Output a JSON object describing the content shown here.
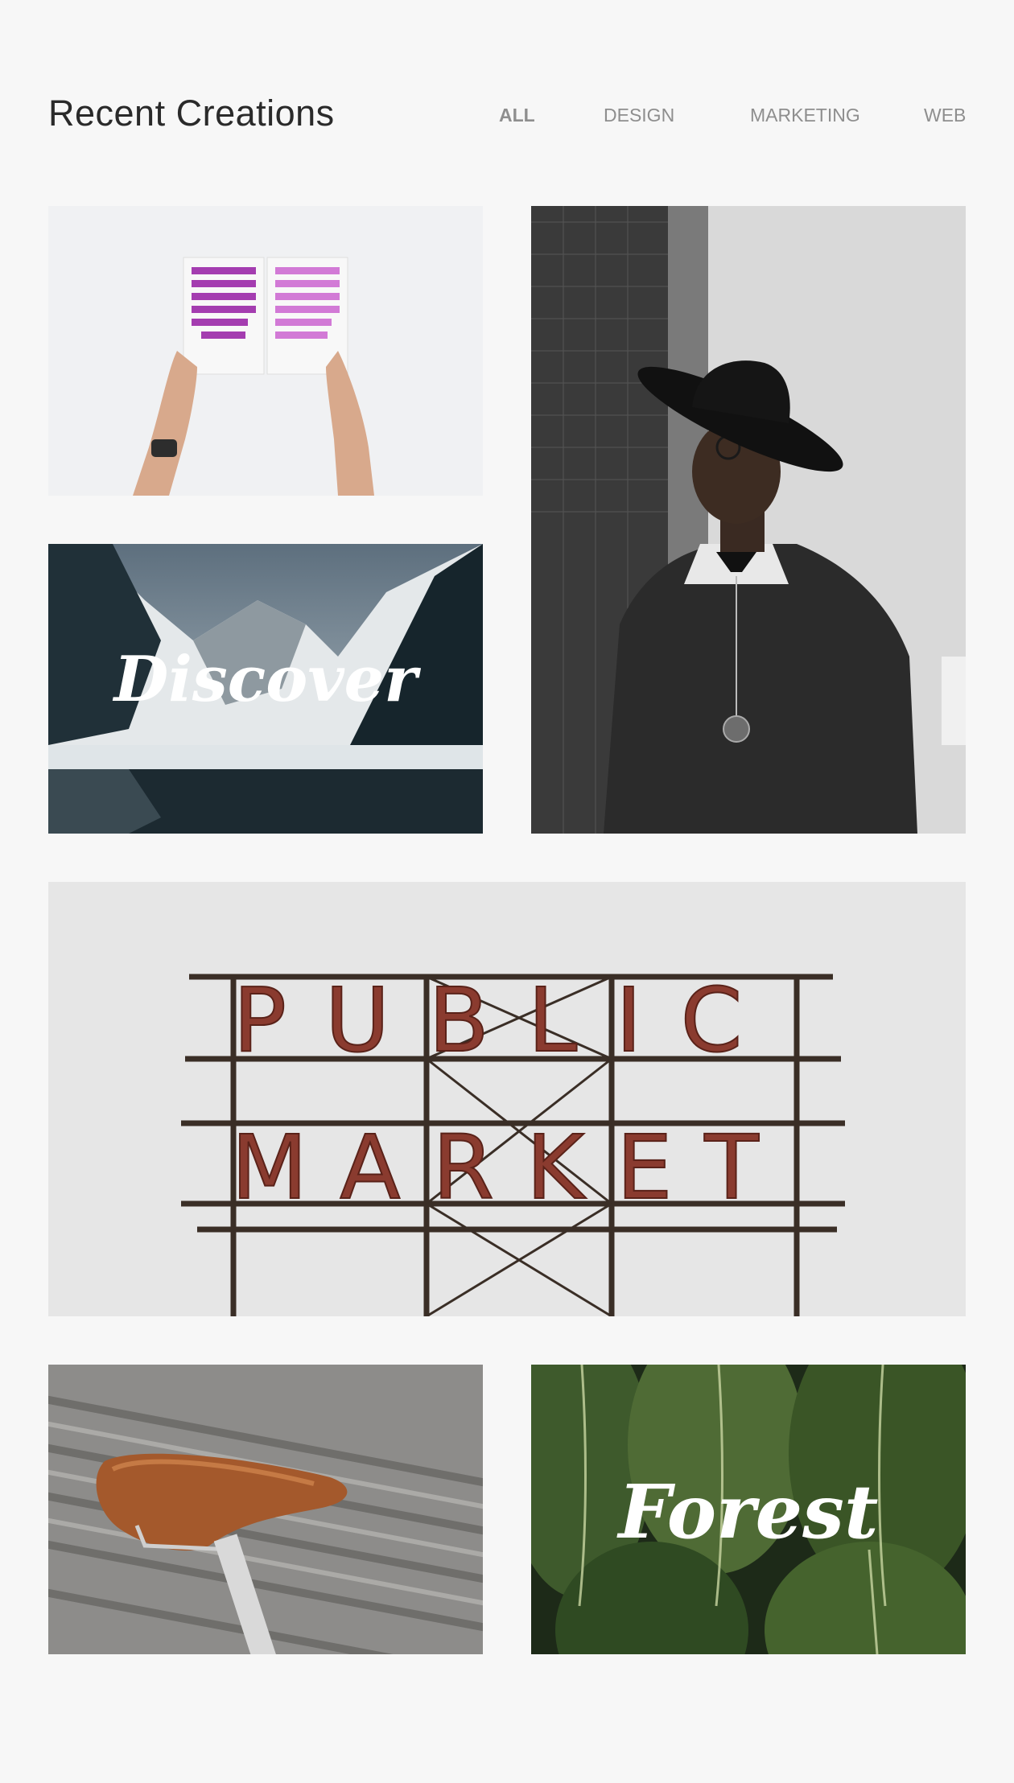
{
  "header": {
    "title": "Recent Creations"
  },
  "filters": [
    {
      "label": "ALL",
      "active": true
    },
    {
      "label": "DESIGN",
      "active": false
    },
    {
      "label": "MARKETING",
      "active": false
    },
    {
      "label": "WEB",
      "active": false
    }
  ],
  "gallery": {
    "discover_text": "Discover",
    "public_text": "PUBLIC",
    "market_text": "MARKET",
    "forest_text": "Forest"
  },
  "colors": {
    "background": "#f7f7f7",
    "title": "#2a2a2a",
    "nav": "#8e8e8e",
    "sign_letters": "#8a3b2f"
  }
}
